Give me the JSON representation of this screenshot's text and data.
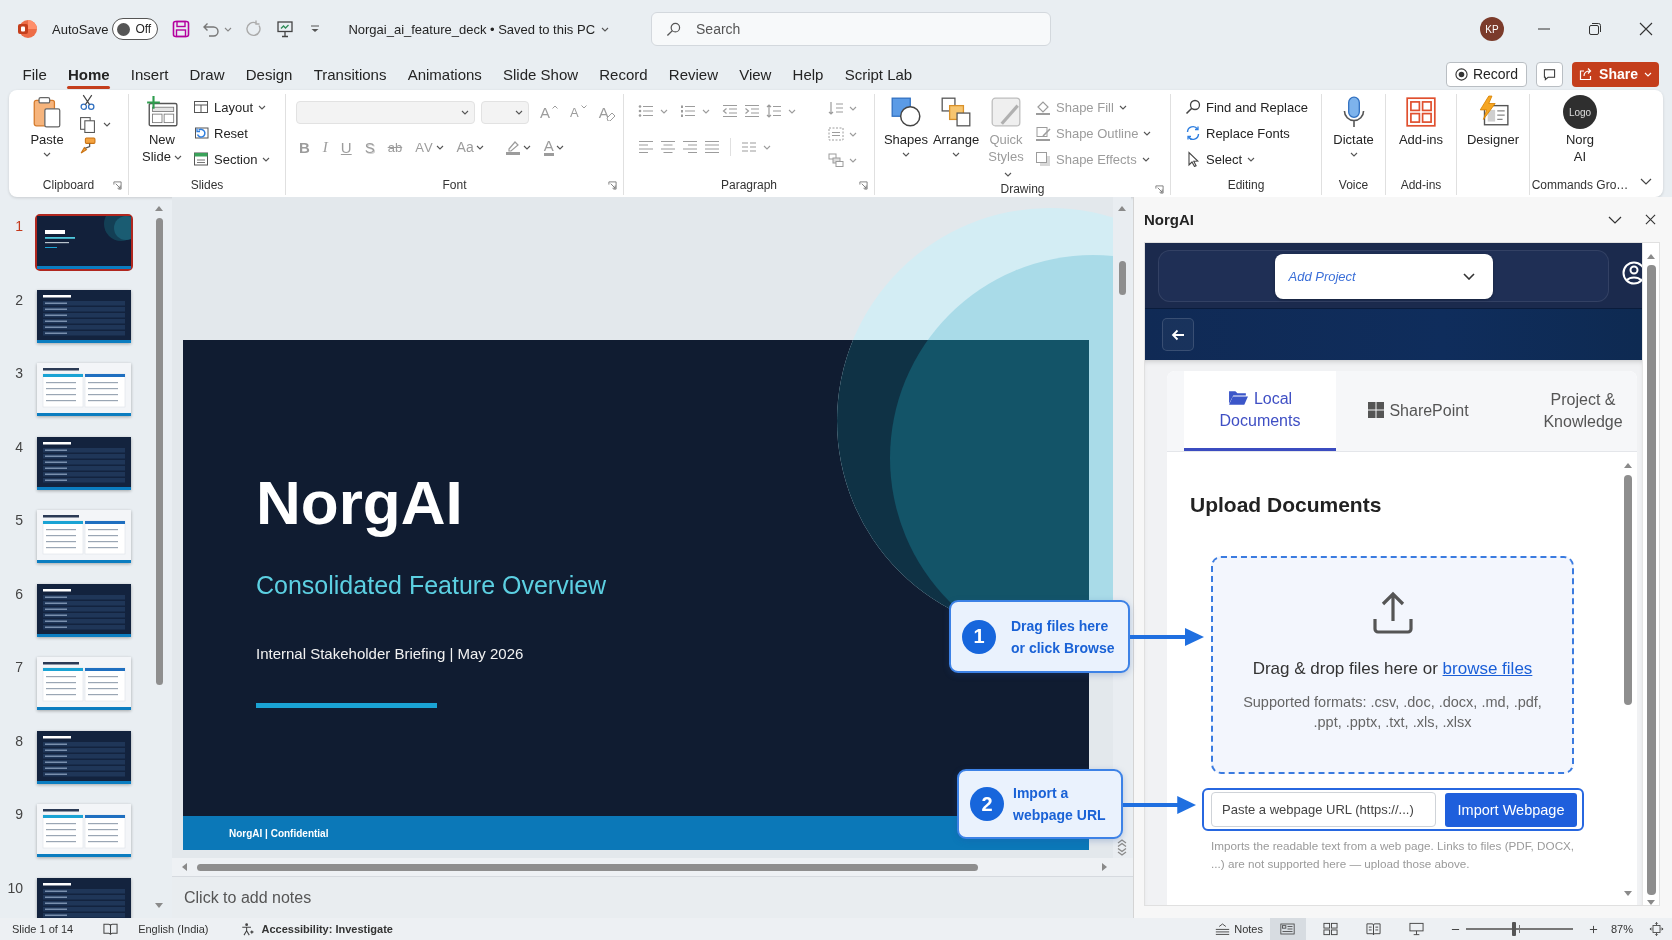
{
  "title_bar": {
    "autosave": {
      "label": "AutoSave",
      "on": false,
      "state_text": "Off"
    },
    "document_title": "Norgai_ai_feature_deck • Saved to this PC",
    "search": {
      "placeholder": "Search"
    },
    "user_initials": "KP"
  },
  "ribbon": {
    "tabs": [
      {
        "label": "File",
        "selected": false
      },
      {
        "label": "Home",
        "selected": true
      },
      {
        "label": "Insert",
        "selected": false
      },
      {
        "label": "Draw",
        "selected": false
      },
      {
        "label": "Design",
        "selected": false
      },
      {
        "label": "Transitions",
        "selected": false
      },
      {
        "label": "Animations",
        "selected": false
      },
      {
        "label": "Slide Show",
        "selected": false
      },
      {
        "label": "Record",
        "selected": false
      },
      {
        "label": "Review",
        "selected": false
      },
      {
        "label": "View",
        "selected": false
      },
      {
        "label": "Help",
        "selected": false
      },
      {
        "label": "Script Lab",
        "selected": false
      }
    ],
    "record_button": "Record",
    "share_button": "Share",
    "groups": [
      {
        "kind": "clipboard",
        "label": "Clipboard",
        "launcher": true,
        "large_buttons": [
          {
            "kind": "paste",
            "label": "Paste",
            "has_menu": true
          }
        ]
      },
      {
        "kind": "slides",
        "label": "Slides",
        "large_buttons": [
          {
            "kind": "new_slide",
            "label": "New Slide",
            "has_menu": true
          }
        ],
        "commands": [
          {
            "kind": "layout",
            "label": "Layout",
            "has_menu": true
          },
          {
            "kind": "reset",
            "label": "Reset"
          },
          {
            "kind": "section",
            "label": "Section",
            "has_menu": true
          }
        ]
      },
      {
        "kind": "font",
        "label": "Font",
        "launcher": true,
        "disabled": true,
        "top_commands": [
          {
            "kind": "grow",
            "glyph": "A"
          },
          {
            "kind": "shrink",
            "glyph": "A"
          },
          {
            "kind": "clear",
            "glyph": "A"
          }
        ],
        "bottom_commands": [
          {
            "kind": "bold",
            "glyph": "B"
          },
          {
            "kind": "italic",
            "glyph": "I"
          },
          {
            "kind": "underline",
            "glyph": "U"
          },
          {
            "kind": "shadow",
            "glyph": "S"
          },
          {
            "kind": "strikethrough",
            "glyph": "ab"
          },
          {
            "kind": "spacing",
            "glyph": "AV",
            "has_menu": true
          },
          {
            "kind": "case",
            "glyph": "Aa",
            "has_menu": true
          },
          {
            "kind": "highlight",
            "has_menu": true
          },
          {
            "kind": "color",
            "glyph": "A",
            "has_menu": true
          }
        ]
      },
      {
        "kind": "paragraph",
        "label": "Paragraph",
        "launcher": true,
        "disabled": true
      },
      {
        "kind": "drawing",
        "label": "Drawing",
        "launcher": true,
        "large_buttons": [
          {
            "kind": "shapes",
            "label": "Shapes",
            "has_menu": true,
            "disabled": false
          },
          {
            "kind": "arrange",
            "label": "Arrange",
            "has_menu": true,
            "disabled": false
          },
          {
            "kind": "quick_styles",
            "label": "Quick Styles",
            "has_menu": true,
            "disabled": true
          }
        ],
        "commands": [
          {
            "kind": "fill",
            "label": "Shape Fill",
            "has_menu": true,
            "disabled": true
          },
          {
            "kind": "outline",
            "label": "Shape Outline",
            "has_menu": true,
            "disabled": true
          },
          {
            "kind": "effects",
            "label": "Shape Effects",
            "has_menu": true,
            "disabled": true
          }
        ]
      },
      {
        "kind": "editing",
        "label": "Editing",
        "commands": [
          {
            "kind": "find",
            "label": "Find and Replace"
          },
          {
            "kind": "replace_fonts",
            "label": "Replace Fonts"
          },
          {
            "kind": "select",
            "label": "Select",
            "has_menu": true
          }
        ]
      },
      {
        "kind": "voice",
        "label": "Voice",
        "large_buttons": [
          {
            "kind": "dictate",
            "label": "Dictate",
            "has_menu": true
          }
        ]
      },
      {
        "kind": "addins",
        "label": "Add-ins",
        "large_buttons": [
          {
            "kind": "addins",
            "label": "Add-ins"
          }
        ]
      },
      {
        "kind": "designer",
        "large_buttons": [
          {
            "kind": "designer",
            "label": "Designer"
          }
        ]
      },
      {
        "kind": "commands",
        "label": "Commands Gro…",
        "large_buttons": [
          {
            "kind": "logo",
            "label": "Norg AI",
            "logo_text": "Logo"
          }
        ]
      }
    ]
  },
  "slides": [
    {
      "number": "1",
      "selected": true,
      "kind": "title"
    },
    {
      "number": "2",
      "selected": false,
      "kind": "dark"
    },
    {
      "number": "3",
      "selected": false,
      "kind": "light"
    },
    {
      "number": "4",
      "selected": false,
      "kind": "dark"
    },
    {
      "number": "5",
      "selected": false,
      "kind": "light"
    },
    {
      "number": "6",
      "selected": false,
      "kind": "dark"
    },
    {
      "number": "7",
      "selected": false,
      "kind": "light"
    },
    {
      "number": "8",
      "selected": false,
      "kind": "dark"
    },
    {
      "number": "9",
      "selected": false,
      "kind": "light"
    },
    {
      "number": "10",
      "selected": false,
      "kind": "dark"
    }
  ],
  "slide": {
    "title": "NorgAI",
    "subtitle": "Consolidated Feature Overview",
    "tagline": "Internal Stakeholder Briefing | May 2026",
    "footer": "NorgAI | Confidential"
  },
  "notes": {
    "placeholder": "Click to add notes"
  },
  "task_pane": {
    "title": "NorgAI",
    "project_select": {
      "placeholder": "Add Project"
    },
    "source_tabs": [
      {
        "kind": "local",
        "label": "Local Documents",
        "selected": true
      },
      {
        "kind": "sharepoint",
        "label": "SharePoint",
        "selected": false
      },
      {
        "kind": "project",
        "label": "Project & Knowledge",
        "selected": false
      }
    ],
    "heading": "Upload Documents",
    "dropzone": {
      "text": "Drag & drop files here or",
      "link": "browse files",
      "formats": "Supported formats: .csv, .doc, .docx, .md, .pdf, .ppt, .pptx, .txt, .xls, .xlsx"
    },
    "url_import": {
      "placeholder": "Paste a webpage URL (https://...)",
      "button": "Import Webpage",
      "help": "Imports the readable text from a web page. Links to files (PDF, DOCX, ...) are not supported here — upload those above."
    }
  },
  "callouts": [
    {
      "number": "1",
      "text": "Drag files here or click Browse"
    },
    {
      "number": "2",
      "text": "Import a webpage URL"
    }
  ],
  "status_bar": {
    "slide_position": "Slide 1 of 14",
    "language": "English (India)",
    "accessibility": "Accessibility: Investigate",
    "notes": "Notes",
    "views": [
      {
        "kind": "normal",
        "selected": true
      },
      {
        "kind": "sorter",
        "selected": false
      },
      {
        "kind": "reading",
        "selected": false
      },
      {
        "kind": "slideshow",
        "selected": false
      }
    ],
    "zoom": {
      "level": 0.45,
      "reading": "87%"
    }
  }
}
